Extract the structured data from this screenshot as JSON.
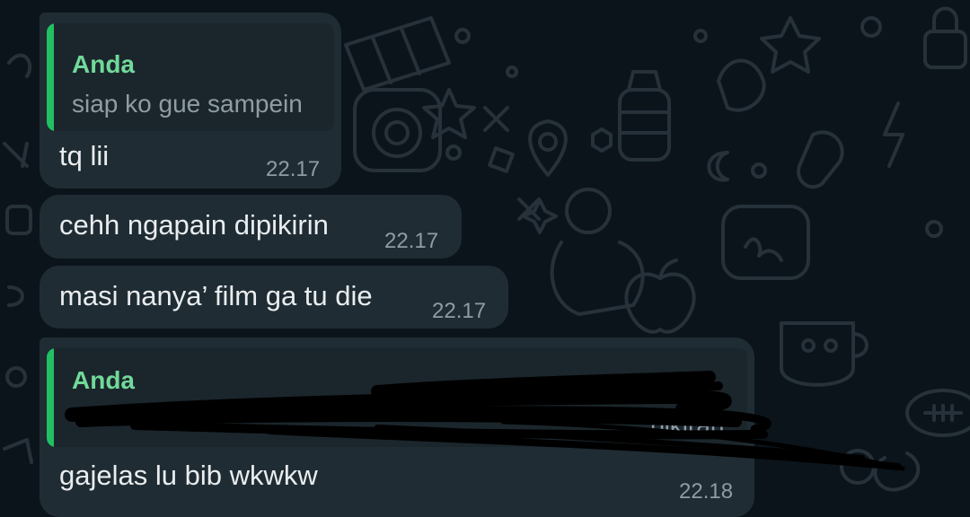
{
  "colors": {
    "background": "#0b141a",
    "bubble": "#1f2c33",
    "quote_bar": "#21c063",
    "quote_author": "#71d99a"
  },
  "messages": [
    {
      "quote": {
        "author": "Anda",
        "text": "siap ko gue sampein"
      },
      "text": "tq lii",
      "time": "22.17"
    },
    {
      "text": "cehh ngapain dipikirin",
      "time": "22.17"
    },
    {
      "text": "masi nanya’ film ga tu die",
      "time": "22.17"
    },
    {
      "quote": {
        "author": "Anda",
        "text": "pikiran"
      },
      "text": "gajelas lu bib wkwkw",
      "time": "22.18"
    }
  ]
}
